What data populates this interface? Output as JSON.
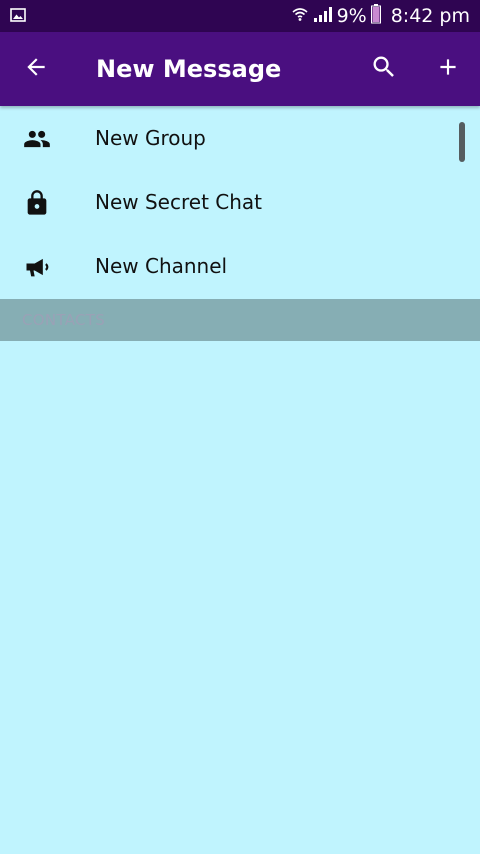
{
  "status_bar": {
    "notification_icon": "image-icon",
    "wifi_icon": "wifi-icon",
    "signal_icon": "signal-icon",
    "battery_percent": "9%",
    "battery_icon": "battery-icon",
    "time": "8:42 pm"
  },
  "header": {
    "title": "New Message",
    "back_icon": "arrow-back-icon",
    "search_icon": "search-icon",
    "add_icon": "plus-icon"
  },
  "menu": {
    "items": [
      {
        "label": "New Group",
        "icon": "group-icon"
      },
      {
        "label": "New Secret Chat",
        "icon": "lock-icon"
      },
      {
        "label": "New Channel",
        "icon": "megaphone-icon"
      }
    ]
  },
  "contacts_section": {
    "label": "CONTACTS"
  },
  "colors": {
    "status_bar": "#2f0552",
    "app_bar": "#4a0f80",
    "background": "#c0f4fe",
    "section_header": "#86aeb4",
    "section_text": "#9aa1b6"
  }
}
